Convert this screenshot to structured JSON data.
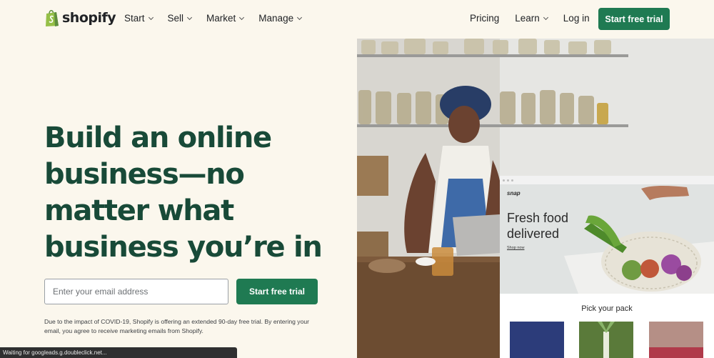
{
  "brand": {
    "name": "shopify",
    "accent": "#1f7a52",
    "headline_color": "#184a38",
    "background": "#fbf7ed"
  },
  "nav": {
    "primary": [
      {
        "label": "Start",
        "has_dropdown": true
      },
      {
        "label": "Sell",
        "has_dropdown": true
      },
      {
        "label": "Market",
        "has_dropdown": true
      },
      {
        "label": "Manage",
        "has_dropdown": true
      }
    ],
    "secondary": [
      {
        "label": "Pricing",
        "has_dropdown": false
      },
      {
        "label": "Learn",
        "has_dropdown": true
      },
      {
        "label": "Log in",
        "has_dropdown": false
      }
    ],
    "cta_label": "Start free trial"
  },
  "hero": {
    "headline": "Build an online business—no matter what business you’re in",
    "email_placeholder": "Enter your email address",
    "cta_label": "Start free trial",
    "disclaimer": "Due to the impact of COVID-19, Shopify is offering an extended 90-day free trial. By entering your email, you agree to receive marketing emails from Shopify."
  },
  "mock_store": {
    "brand": "snap",
    "title": "Fresh food delivered",
    "link": "Shop now",
    "section_title": "Pick your pack"
  },
  "status_bar": {
    "text": "Waiting for googleads.g.doubleclick.net..."
  }
}
